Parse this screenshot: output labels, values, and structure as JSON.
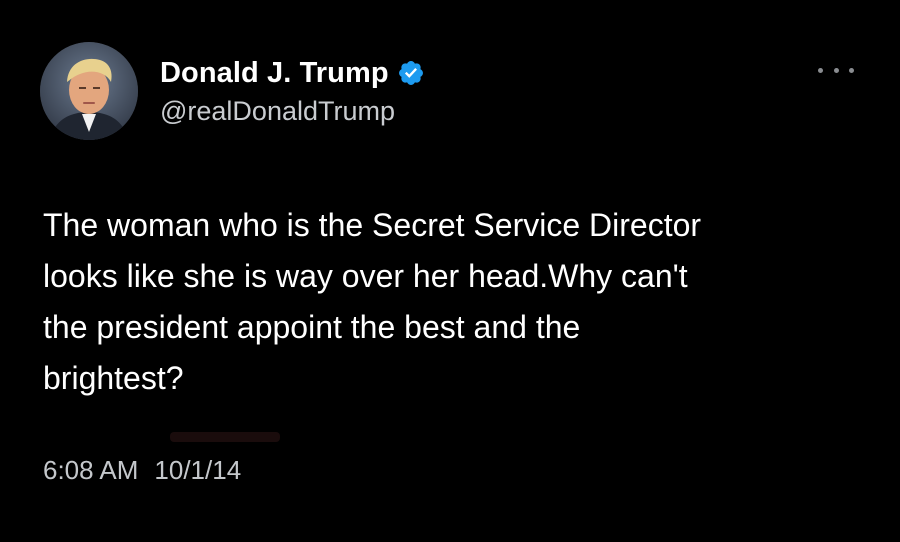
{
  "tweet": {
    "display_name": "Donald J. Trump",
    "handle": "@realDonaldTrump",
    "verified_icon": "verified-badge-icon",
    "more_icon": "more-options-icon",
    "text": "The woman who is the Secret Service Director\nlooks like she is way over her head.Why can't\nthe president appoint the best and the\nbrightest?",
    "time": "6:08 AM",
    "date": "10/1/14"
  },
  "colors": {
    "background": "#000000",
    "text": "#ffffff",
    "secondary_text": "#c9ccd0",
    "verified_blue": "#1d9bf0"
  }
}
